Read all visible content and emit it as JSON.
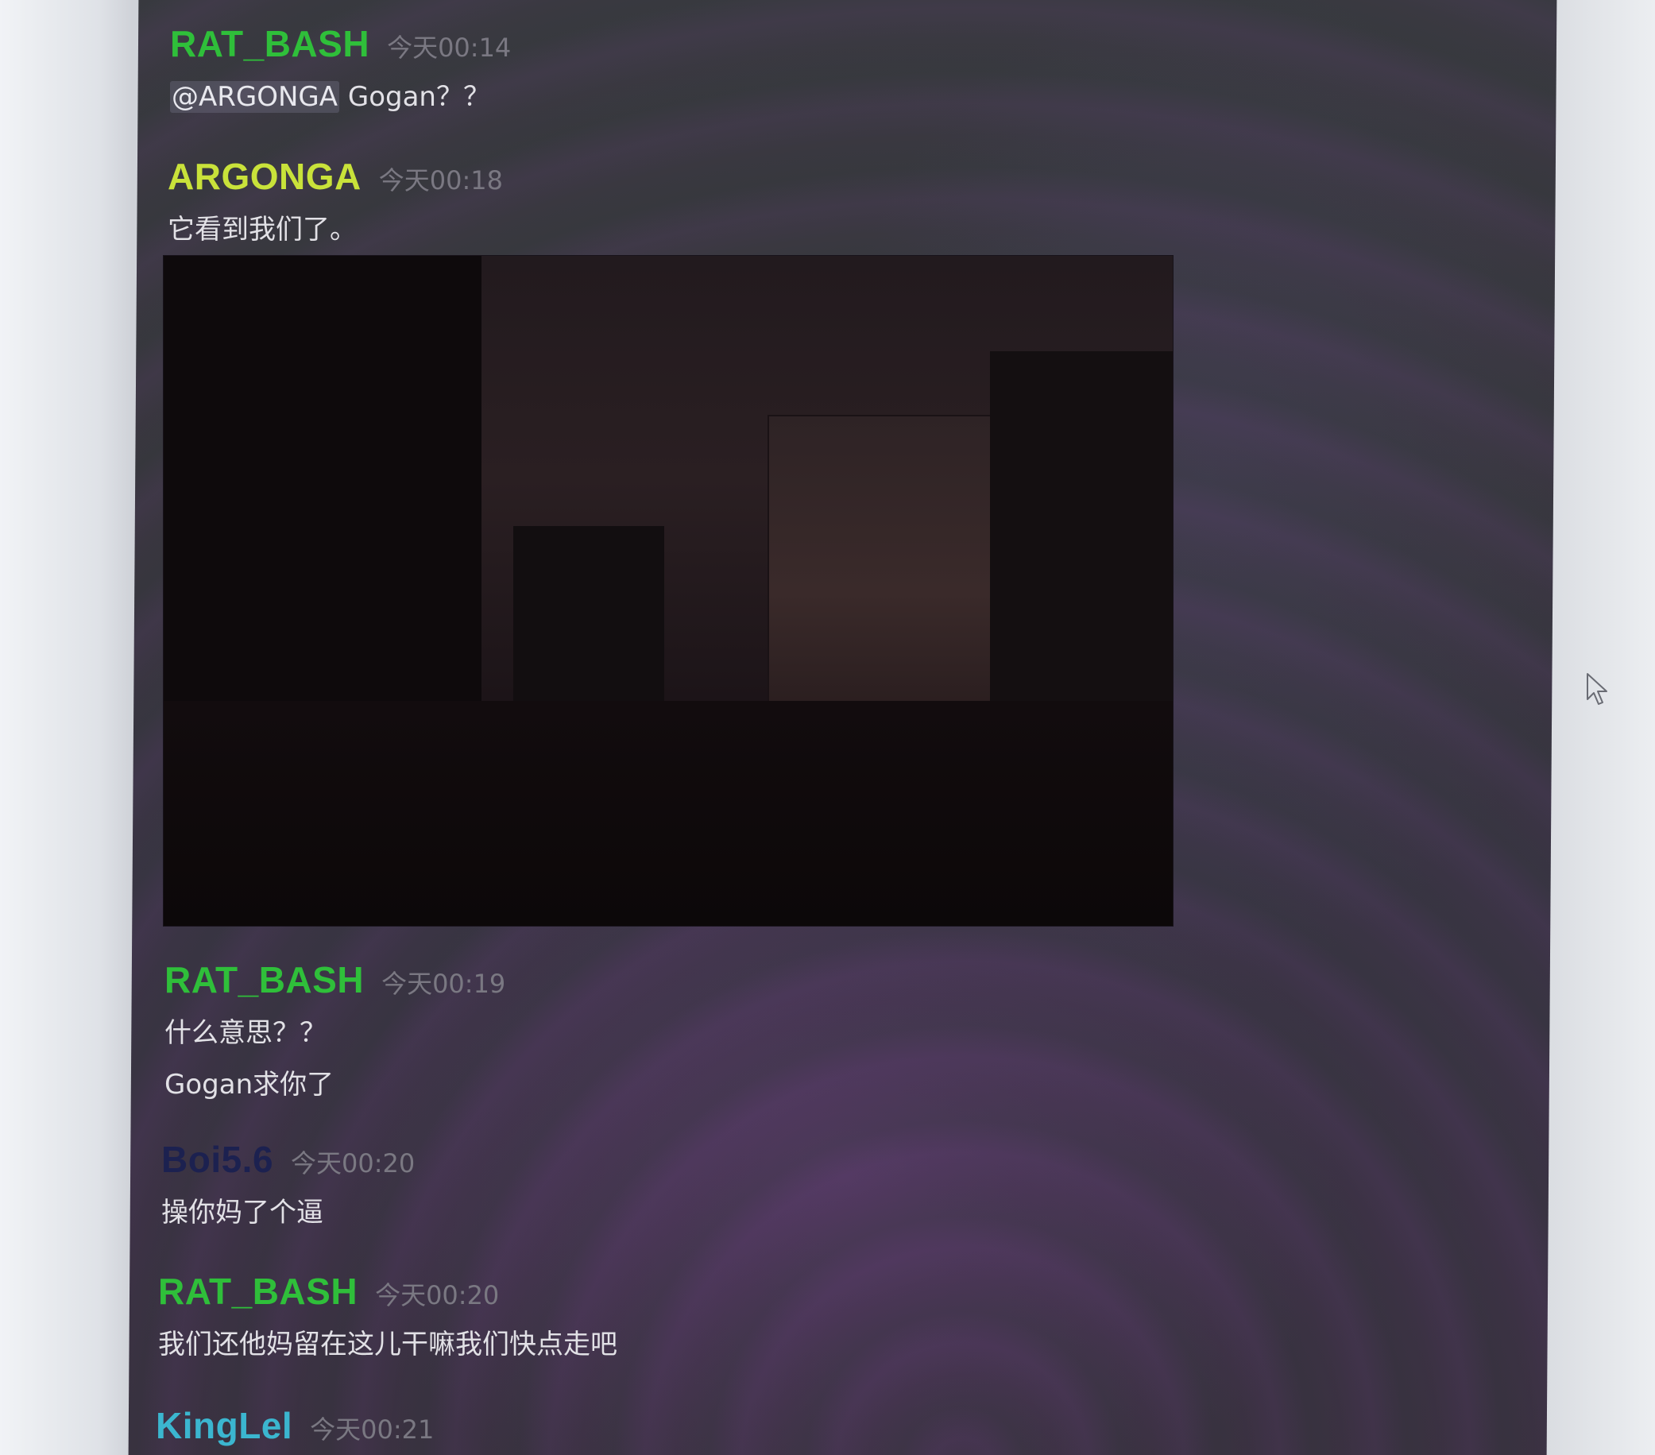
{
  "colors": {
    "rat_bash": "#2fbf3a",
    "argonga": "#c9e23a",
    "boi": "#1c2150",
    "kinglel": "#3bb6cf",
    "timestamp": "#7a7882",
    "text": "#e2e1e6"
  },
  "messages": [
    {
      "username": "RAT_BASH",
      "timestamp": "今天00:14",
      "mention": "@ARGONGA",
      "lines": [
        "Gogan？？"
      ]
    },
    {
      "username": "ARGONGA",
      "timestamp": "今天00:18",
      "lines": [
        "它看到我们了。"
      ],
      "attachment": "image"
    },
    {
      "username": "RAT_BASH",
      "timestamp": "今天00:19",
      "lines": [
        "什么意思？？",
        "Gogan求你了"
      ]
    },
    {
      "username": "Boi5.6",
      "timestamp": "今天00:20",
      "lines": [
        "操你妈了个逼"
      ]
    },
    {
      "username": "RAT_BASH",
      "timestamp": "今天00:20",
      "lines": [
        "我们还他妈留在这儿干嘛我们快点走吧"
      ]
    },
    {
      "username": "KingLel",
      "timestamp": "今天00:21",
      "lines": []
    }
  ],
  "icons": {
    "cursor": "mouse-pointer-icon"
  }
}
